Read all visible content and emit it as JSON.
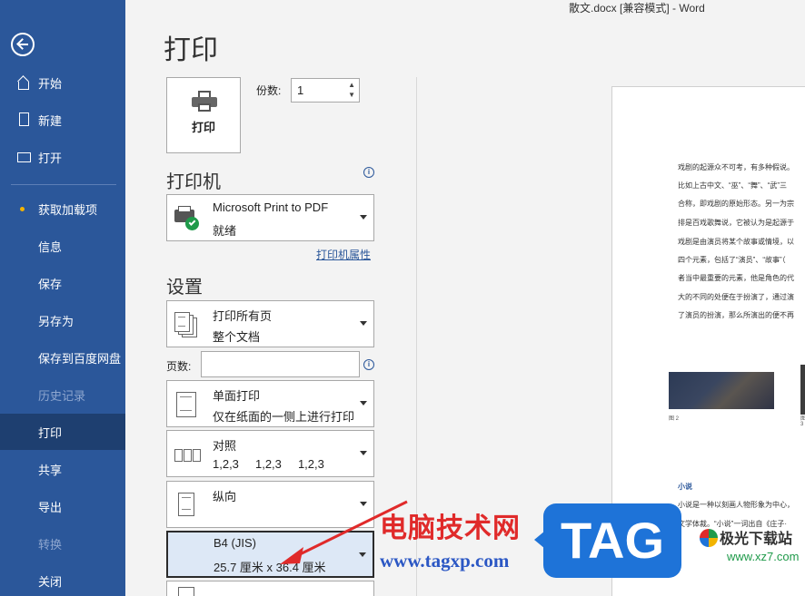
{
  "window": {
    "title": "散文.docx [兼容模式]  -  Word"
  },
  "sidebar": {
    "items": [
      {
        "label": "开始"
      },
      {
        "label": "新建"
      },
      {
        "label": "打开"
      },
      {
        "label": "获取加载项"
      },
      {
        "label": "信息"
      },
      {
        "label": "保存"
      },
      {
        "label": "另存为"
      },
      {
        "label": "保存到百度网盘"
      },
      {
        "label": "历史记录"
      },
      {
        "label": "打印"
      },
      {
        "label": "共享"
      },
      {
        "label": "导出"
      },
      {
        "label": "转换"
      },
      {
        "label": "关闭"
      }
    ],
    "active": "打印"
  },
  "main": {
    "title": "打印",
    "print_button": "打印",
    "copies": {
      "label": "份数:",
      "value": "1"
    },
    "printer": {
      "section_title": "打印机",
      "name": "Microsoft Print to PDF",
      "status": "就绪",
      "properties_link": "打印机属性"
    },
    "settings": {
      "section_title": "设置",
      "print_range": {
        "line1": "打印所有页",
        "line2": "整个文档"
      },
      "pages": {
        "label": "页数:",
        "value": ""
      },
      "sides": {
        "line1": "单面打印",
        "line2": "仅在纸面的一侧上进行打印"
      },
      "collation": {
        "line1": "对照",
        "line2": "1,2,3     1,2,3     1,2,3"
      },
      "orientation": {
        "line1": "纵向"
      },
      "paper_size": {
        "line1": "B4 (JIS)",
        "line2": "25.7 厘米 x 36.4 厘米"
      }
    }
  },
  "preview": {
    "lines": [
      "戏剧的起源众不可考，有多种假说。",
      "比如上古中文、“巫”、“舞”、“武”三",
      "合称，即戏剧的原始形态。另一为宗",
      "排是百戏歌舞说，它被认为是起源于",
      "戏剧是由演员将某个故事或情境，以",
      "四个元素，包括了“演员”、“故事”（",
      "者当中最重要的元素，他是角色的代",
      "大的不同的处便在于扮演了，通过演",
      "了演员的扮演，那么所演出的便不再"
    ],
    "caption1": "图 2",
    "caption2": "图 3",
    "heading": "小说",
    "para_line1": "小说是一种以刻画人物形象为中心，",
    "para_line2": "文学体裁。“小说”一词出自《庄子·"
  },
  "watermark": {
    "cn": "电脑技术网",
    "url": "www.tagxp.com",
    "tag": "TAG",
    "site_cn": "极光下载站",
    "site_url": "www.xz7.com"
  },
  "colors": {
    "sidebar": "#2b579a",
    "active": "#1e3f70",
    "accent": "#2b579a",
    "annotation": "#e02a2a"
  }
}
